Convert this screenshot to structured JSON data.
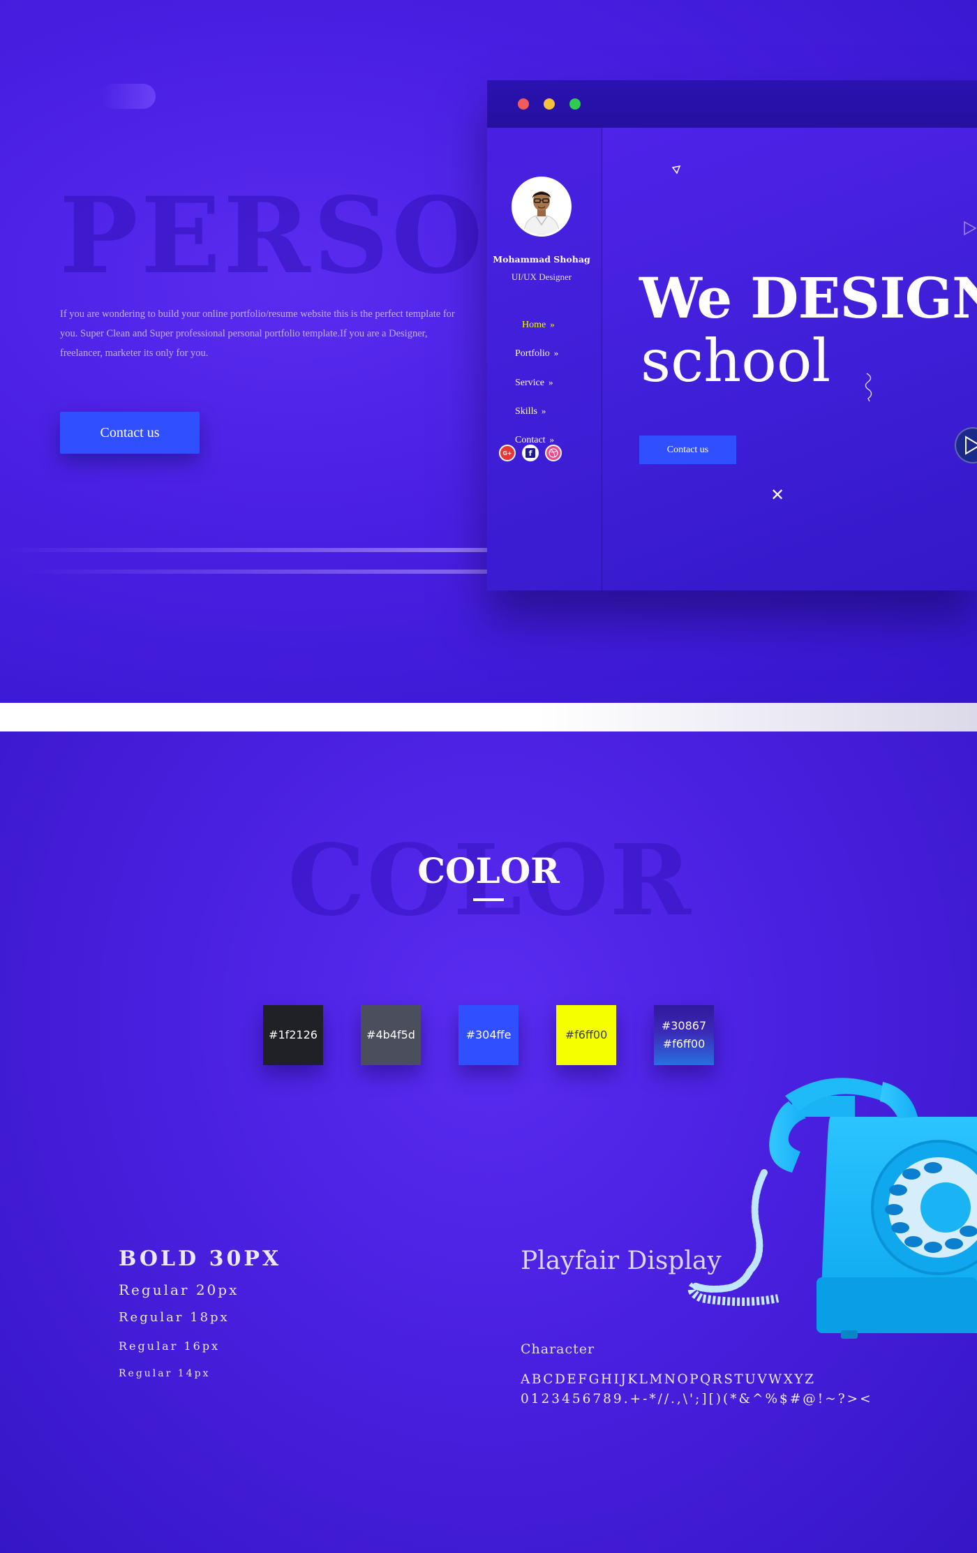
{
  "hero": {
    "ghost_title": "PERSONAL",
    "description": "If you are wondering to build your online portfolio/resume website this is the perfect template for you. Super Clean and Super professional personal portfolio template.If you are a Designer, freelancer, marketer its only for you.",
    "cta_label": "Contact us"
  },
  "mockup": {
    "window_controls": [
      "close",
      "minimize",
      "maximize"
    ],
    "profile": {
      "name": "Mohammad Shohag",
      "role": "UI/UX Designer"
    },
    "nav": [
      {
        "label": "Home",
        "active": true
      },
      {
        "label": "Portfolio",
        "active": false
      },
      {
        "label": "Service",
        "active": false
      },
      {
        "label": "Skills",
        "active": false
      },
      {
        "label": "Contact",
        "active": false
      }
    ],
    "nav_chevron": "»",
    "headline_bold": "We DESIGN",
    "headline_regular": "school",
    "cta_label": "Contact us",
    "close_glyph": "✕",
    "social_icons": [
      "google-plus-icon",
      "facebook-icon",
      "dribbble-icon"
    ],
    "social_glyphs": {
      "google": "G+",
      "facebook": "f"
    }
  },
  "color_section": {
    "ghost_title": "COLOR",
    "title": "COLOR",
    "swatches": [
      {
        "label": "#1f2126",
        "color": "#1f2126"
      },
      {
        "label": "#4b4f5d",
        "color": "#4b4f5d"
      },
      {
        "label": "#304ffe",
        "color": "#304ffe"
      },
      {
        "label": "#f6ff00",
        "color": "#f6ff00"
      },
      {
        "label_top": "#30867",
        "label_bottom": "#f6ff00",
        "gradient": [
          "#30189a",
          "#2a6fe0"
        ]
      }
    ]
  },
  "typography": {
    "bold_sample": "BOLD 30PX",
    "regular_20": "Regular 20px",
    "regular_18": "Regular 18px",
    "regular_16": "Regular 16px",
    "regular_14": "Regular 14px",
    "font_name": "Playfair Display",
    "character_label": "Character",
    "alphabet": "ABCDEFGHIJKLMNOPQRSTUVWXYZ",
    "numbers_symbols": "0123456789.+-*//.,\\';][)(*&^%$#@!~?><"
  },
  "colors": {
    "accent_blue": "#304ffe",
    "active_yellow": "#f6ff00",
    "background_purple": "#4a20e4"
  }
}
